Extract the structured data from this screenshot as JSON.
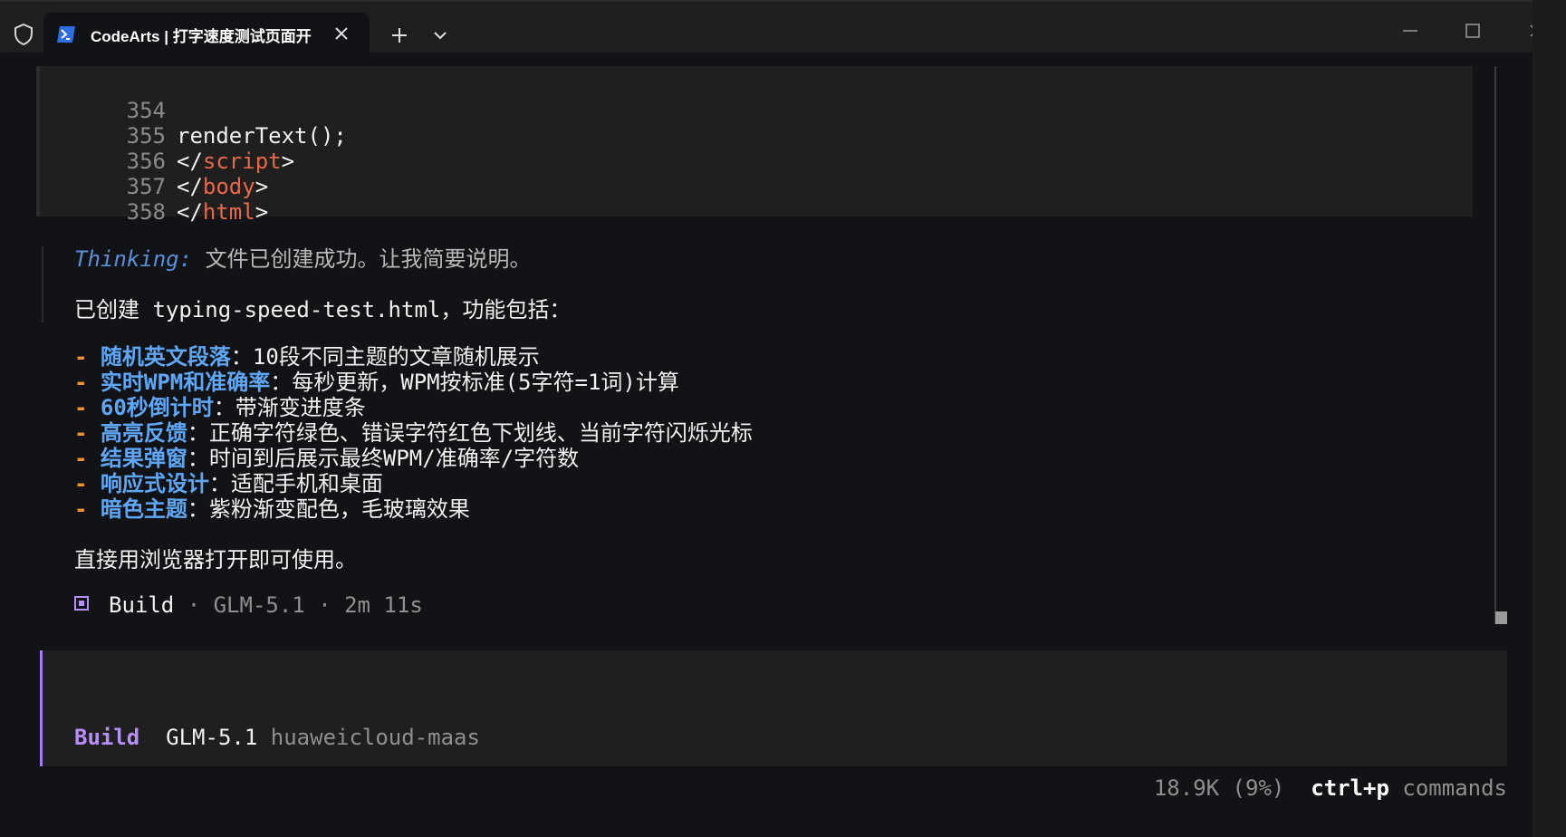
{
  "window": {
    "tab_title": "CodeArts | 打字速度测试页面开",
    "icons": [
      "shield-icon",
      "powershell-icon",
      "close-icon",
      "plus-icon",
      "chevron-down-icon",
      "minimize-icon",
      "maximize-icon"
    ]
  },
  "code_block": {
    "lines": [
      {
        "num": "354",
        "text": "renderText();"
      },
      {
        "num": "355",
        "open": "</",
        "tag": "script",
        "close": ">"
      },
      {
        "num": "356",
        "open": "</",
        "tag": "body",
        "close": ">"
      },
      {
        "num": "357",
        "open": "</",
        "tag": "html",
        "close": ">"
      },
      {
        "num": "358",
        "text": ""
      }
    ]
  },
  "response": {
    "thinking_label": "Thinking:",
    "thinking_text": "文件已创建成功。让我简要说明。",
    "intro_prefix": "已创建 ",
    "intro_file": "typing-speed-test.html",
    "intro_suffix": "，功能包括：",
    "bullets": [
      {
        "dash": "- ",
        "key": "随机英文段落",
        "text": "：10段不同主题的文章随机展示"
      },
      {
        "dash": "- ",
        "key": "实时WPM和准确率",
        "text": "：每秒更新，WPM按标准(5字符=1词)计算"
      },
      {
        "dash": "- ",
        "key": "60秒倒计时",
        "text": "：带渐变进度条"
      },
      {
        "dash": "- ",
        "key": "高亮反馈",
        "text": "：正确字符绿色、错误字符红色下划线、当前字符闪烁光标"
      },
      {
        "dash": "- ",
        "key": "结果弹窗",
        "text": "：时间到后展示最终WPM/准确率/字符数"
      },
      {
        "dash": "- ",
        "key": "响应式设计",
        "text": "：适配手机和桌面"
      },
      {
        "dash": "- ",
        "key": "暗色主题",
        "text": "：紫粉渐变配色，毛玻璃效果"
      }
    ],
    "closing": "直接用浏览器打开即可使用。",
    "build_label": "Build",
    "build_meta": " · GLM-5.1 · 2m 11s"
  },
  "input": {
    "agent": "Build",
    "model": "GLM-5.1",
    "provider": "huaweicloud-maas"
  },
  "footer": {
    "tokens": "18.9K (9%)",
    "shortcut": "ctrl+p",
    "commands_label": "commands"
  },
  "colors": {
    "accent_purple": "#b68ff7",
    "bullet_key_blue": "#5fa7f5",
    "dash_orange": "#f3922e",
    "tag_red": "#e8684a",
    "thinking_blue": "#5b8ed6"
  }
}
